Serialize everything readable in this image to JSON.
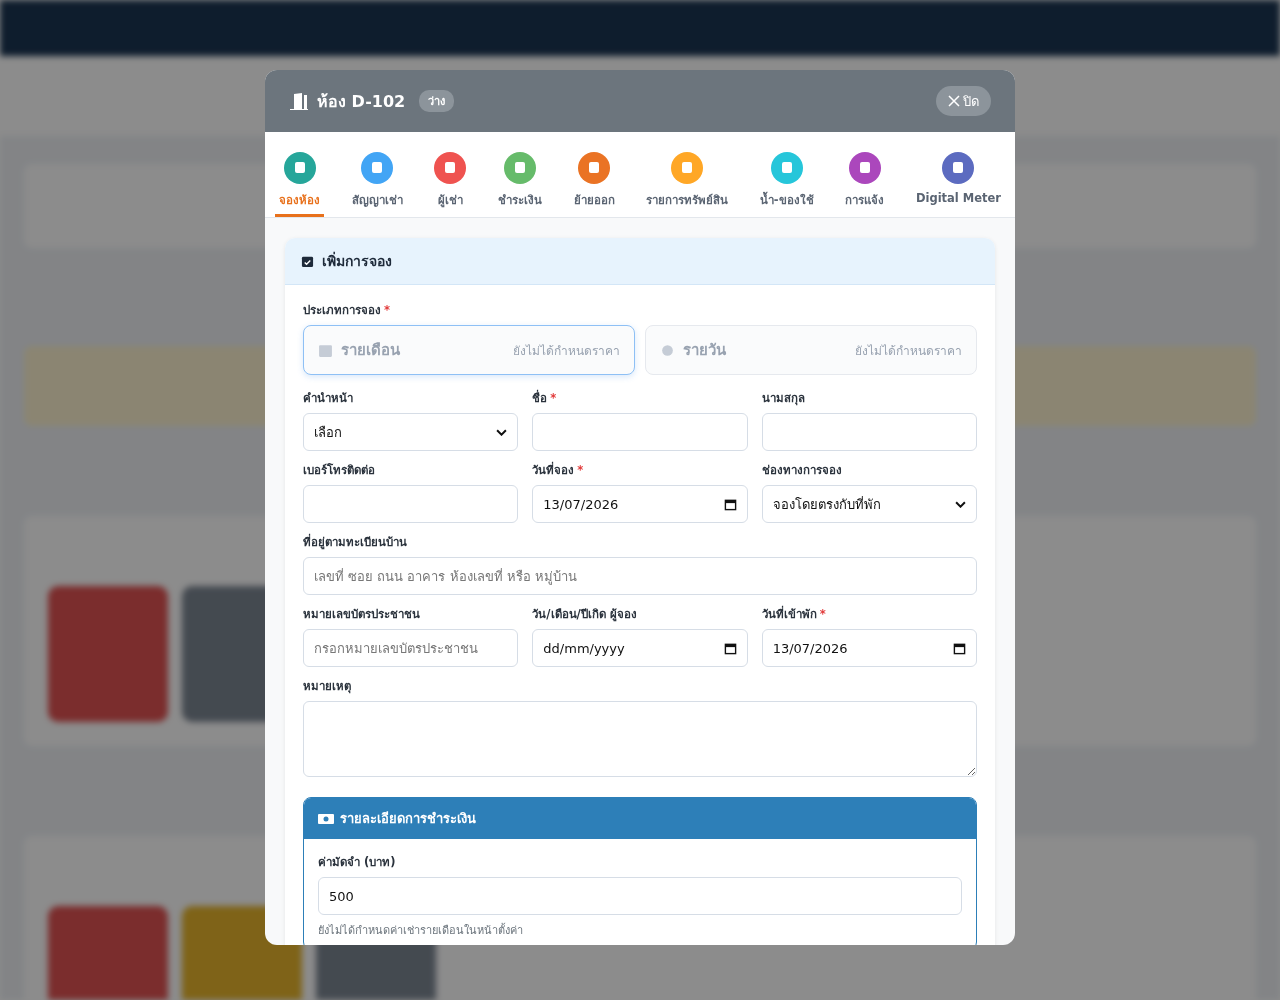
{
  "modal": {
    "title": "ห้อง D-102",
    "status_badge": "ว่าง",
    "close_button": "ปิด"
  },
  "tabs": [
    {
      "label": "จองห้อง",
      "selected": true,
      "color": "#26a69a"
    },
    {
      "label": "สัญญาเช่า",
      "selected": false,
      "color": "#42a5f5"
    },
    {
      "label": "ผู้เช่า",
      "selected": false,
      "color": "#ef5350"
    },
    {
      "label": "ชำระเงิน",
      "selected": false,
      "color": "#66bb6a"
    },
    {
      "label": "ย้ายออก",
      "selected": false,
      "color": "#ea7324"
    },
    {
      "label": "รายการทรัพย์สิน",
      "selected": false,
      "color": "#ffa726"
    },
    {
      "label": "น้ำ-ของใช้",
      "selected": false,
      "color": "#26c6da"
    },
    {
      "label": "การแจ้ง",
      "selected": false,
      "color": "#ab47bc"
    },
    {
      "label": "Digital Meter",
      "selected": false,
      "color": "#5c6bc0"
    }
  ],
  "booking_card": {
    "title": "เพิ่มการจอง",
    "booking_type": {
      "label": "ประเภทการจอง",
      "required_mark": "*",
      "options": [
        {
          "label": "รายเดือน",
          "price_note": "ยังไม่ได้กำหนดราคา",
          "selected": true
        },
        {
          "label": "รายวัน",
          "price_note": "ยังไม่ได้กำหนดราคา",
          "selected": false
        }
      ]
    },
    "rows": [
      [
        {
          "label": "คำนำหน้า",
          "kind": "select",
          "value": "เลือก"
        },
        {
          "label": "ชื่อ",
          "required_mark": "*",
          "kind": "text"
        },
        {
          "label": "นามสกุล",
          "kind": "text"
        }
      ],
      [
        {
          "label": "เบอร์โทรติดต่อ",
          "kind": "text"
        },
        {
          "label": "วันที่จอง",
          "required_mark": "*",
          "kind": "date",
          "value": "13/07/2026"
        },
        {
          "label": "ช่องทางการจอง",
          "kind": "select",
          "value": "จองโดยตรงกับที่พัก"
        }
      ],
      [
        {
          "label": "ที่อยู่ตามทะเบียนบ้าน",
          "kind": "text",
          "placeholder": "เลขที่ ซอย ถนน อาคาร ห้องเลขที่ หรือ หมู่บ้าน"
        }
      ],
      [
        {
          "label": "หมายเลขบัตรประชาชน",
          "kind": "text",
          "placeholder": "กรอกหมายเลขบัตรประชาชน"
        },
        {
          "label": "วัน/เดือน/ปีเกิด ผู้จอง",
          "kind": "date",
          "placeholder": "dd/mm/yyyy"
        },
        {
          "label": "วันที่เข้าพัก",
          "required_mark": "*",
          "kind": "date",
          "value": "13/07/2026"
        }
      ],
      [
        {
          "label": "หมายเหตุ",
          "kind": "textarea"
        }
      ]
    ],
    "payment": {
      "title": "รายละเอียดการชำระเงิน",
      "deposit_label": "ค่ามัดจำ (บาท)",
      "deposit_value": "500",
      "note": "ยังไม่ได้กำหนดค่าเช่ารายเดือนในหน้าตั้งค่า"
    }
  }
}
